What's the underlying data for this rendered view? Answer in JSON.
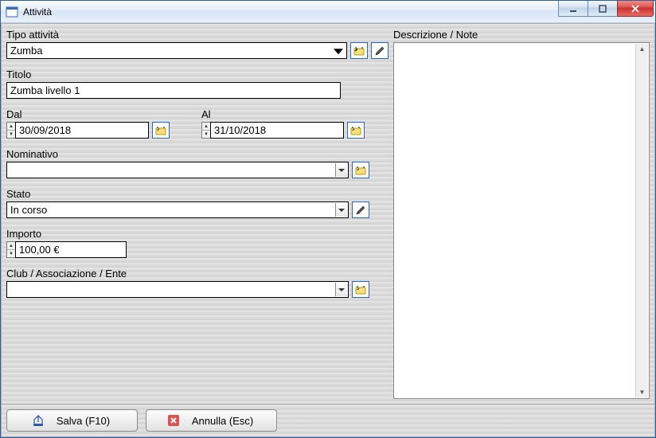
{
  "window": {
    "title": "Attività"
  },
  "labels": {
    "tipo": "Tipo attività",
    "titolo": "Titolo",
    "dal": "Dal",
    "al": "Al",
    "nominativo": "Nominativo",
    "stato": "Stato",
    "importo": "Importo",
    "club": "Club / Associazione / Ente",
    "descrizione": "Descrizione / Note"
  },
  "values": {
    "tipo": "Zumba",
    "titolo": "Zumba livello 1",
    "dal": "30/09/2018",
    "al": "31/10/2018",
    "nominativo": "",
    "stato": "In corso",
    "importo": "100,00 €",
    "club": ""
  },
  "buttons": {
    "save": "Salva (F10)",
    "cancel": "Annulla (Esc)"
  }
}
